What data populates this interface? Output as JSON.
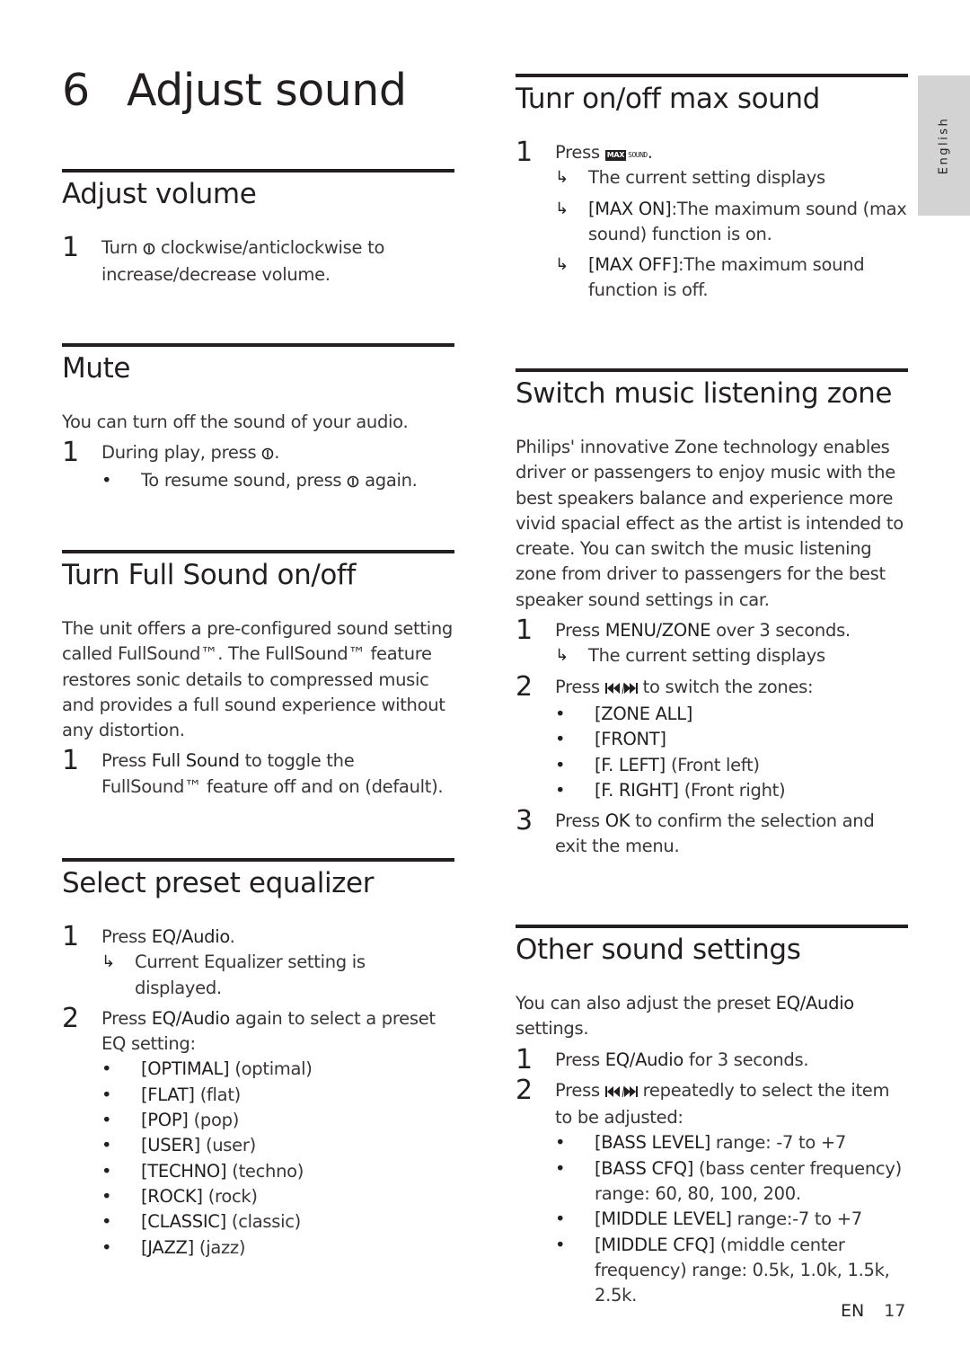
{
  "chapter": {
    "number": "6",
    "title": "Adjust sound"
  },
  "language_tab": "English",
  "footer": {
    "lang": "EN",
    "page": "17"
  },
  "icons": {
    "volume_knob": "volume-knob-icon",
    "max_sound": "max-sound-icon",
    "prev_next": "prev-next-icon",
    "result_arrow": "result-arrow-icon"
  },
  "max_sound_icon": {
    "box": "MAX",
    "text": "SOUND"
  },
  "sections": {
    "adjust_volume": {
      "title": "Adjust volume",
      "steps": [
        {
          "num": "1",
          "pre": "Turn ",
          "post": " clockwise/anticlockwise to increase/decrease volume."
        }
      ]
    },
    "mute": {
      "title": "Mute",
      "intro": "You can turn off the sound of your audio.",
      "steps": [
        {
          "num": "1",
          "pre": "During play, press ",
          "post": "."
        }
      ],
      "bullets": [
        {
          "pre": "To resume sound, press ",
          "post": " again."
        }
      ]
    },
    "full_sound": {
      "title": "Turn Full Sound on/off",
      "intro": "The unit offers a pre-configured sound setting called FullSound™. The FullSound™ feature restores sonic details to compressed music and provides a full sound experience without any distortion.",
      "steps": [
        {
          "num": "1",
          "pre": "Press ",
          "bold": "Full Sound",
          "post": " to toggle the FullSound™ feature off and on (default)."
        }
      ]
    },
    "equalizer": {
      "title": "Select preset equalizer",
      "steps": [
        {
          "num": "1",
          "pre": "Press ",
          "bold": "EQ/Audio",
          "post": "."
        },
        {
          "num": "2",
          "pre": "Press ",
          "bold": "EQ/Audio",
          "post": " again to select a preset EQ setting:"
        }
      ],
      "step1_result": "Current Equalizer setting is displayed.",
      "presets": [
        {
          "code": "[OPTIMAL]",
          "desc": "(optimal)"
        },
        {
          "code": "[FLAT]",
          "desc": "(flat)"
        },
        {
          "code": "[POP]",
          "desc": "(pop)"
        },
        {
          "code": "[USER]",
          "desc": "(user)"
        },
        {
          "code": "[TECHNO]",
          "desc": "(techno)"
        },
        {
          "code": "[ROCK]",
          "desc": "(rock)"
        },
        {
          "code": "[CLASSIC]",
          "desc": "(classic)"
        },
        {
          "code": "[JAZZ]",
          "desc": "(jazz)"
        }
      ]
    },
    "max_sound": {
      "title": "Tunr on/off max sound",
      "steps": [
        {
          "num": "1",
          "pre": "Press ",
          "post": "."
        }
      ],
      "results": [
        {
          "bold": "",
          "text": "The current setting displays"
        },
        {
          "bold": "[MAX ON]",
          "text": ":The maximum sound (max sound) function is on."
        },
        {
          "bold": "[MAX OFF]",
          "text": ":The maximum sound function is off."
        }
      ]
    },
    "zone": {
      "title": "Switch music listening zone",
      "intro": "Philips' innovative Zone technology enables driver or passengers to enjoy music with the best speakers balance and experience more vivid spacial effect as the artist is intended to create. You can switch the music listening zone from driver to passengers for the best speaker sound settings in car.",
      "steps": [
        {
          "num": "1",
          "pre": "Press ",
          "bold": "MENU/ZONE",
          "post": " over 3 seconds."
        },
        {
          "num": "2",
          "pre": "Press ",
          "post": " to switch the zones:"
        },
        {
          "num": "3",
          "pre": "Press ",
          "bold": "OK",
          "post": " to confirm the selection and exit the menu."
        }
      ],
      "step1_result": "The current setting displays",
      "zones": [
        {
          "code": "[ZONE ALL]",
          "desc": ""
        },
        {
          "code": "[FRONT]",
          "desc": ""
        },
        {
          "code": "[F. LEFT]",
          "desc": "(Front left)"
        },
        {
          "code": "[F. RIGHT]",
          "desc": "(Front right)"
        }
      ]
    },
    "other": {
      "title": "Other sound settings",
      "intro_pre": "You can also adjust the preset ",
      "intro_bold": "EQ/Audio",
      "intro_post": " settings.",
      "steps": [
        {
          "num": "1",
          "pre": "Press ",
          "bold": "EQ/Audio",
          "post": " for 3 seconds."
        },
        {
          "num": "2",
          "pre": "Press ",
          "post": " repeatedly to select the item to be adjusted:"
        }
      ],
      "items": [
        {
          "code": "[BASS LEVEL]",
          "desc": " range: -7 to +7"
        },
        {
          "code": "[BASS CFQ]",
          "desc": " (bass center frequency) range: 60, 80, 100, 200."
        },
        {
          "code": "[MIDDLE LEVEL]",
          "desc": " range:-7 to +7"
        },
        {
          "code": "[MIDDLE CFQ]",
          "desc": " (middle center frequency) range: 0.5k, 1.0k, 1.5k, 2.5k."
        }
      ]
    }
  }
}
